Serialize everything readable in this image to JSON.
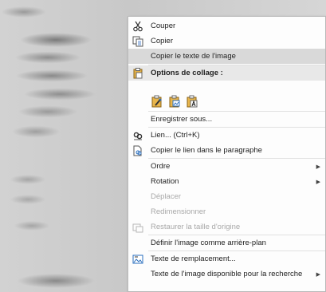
{
  "menu": {
    "items": [
      {
        "label": "Couper",
        "icon": "scissors-icon"
      },
      {
        "label": "Copier",
        "icon": "copy-icon"
      },
      {
        "label": "Copier le texte de l'image",
        "icon": ""
      },
      {
        "label": "Options de collage :",
        "icon": "paste-options-icon"
      },
      {
        "label": "Enregistrer sous...",
        "icon": ""
      },
      {
        "label": "Lien...  (Ctrl+K)",
        "icon": "link-icon"
      },
      {
        "label": "Copier le lien dans le paragraphe",
        "icon": "link-paragraph-icon"
      },
      {
        "label": "Ordre",
        "icon": ""
      },
      {
        "label": "Rotation",
        "icon": ""
      },
      {
        "label": "Déplacer",
        "icon": ""
      },
      {
        "label": "Redimensionner",
        "icon": ""
      },
      {
        "label": "Restaurer la taille d'origine",
        "icon": "restore-size-icon"
      },
      {
        "label": "Définir l'image comme arrière-plan",
        "icon": ""
      },
      {
        "label": "Texte de remplacement...",
        "icon": "alt-text-icon"
      },
      {
        "label": "Texte de l'image disponible pour la recherche",
        "icon": ""
      }
    ],
    "paste_icons": [
      "paste-keep-formatting-icon",
      "paste-picture-icon",
      "paste-text-only-icon"
    ]
  }
}
